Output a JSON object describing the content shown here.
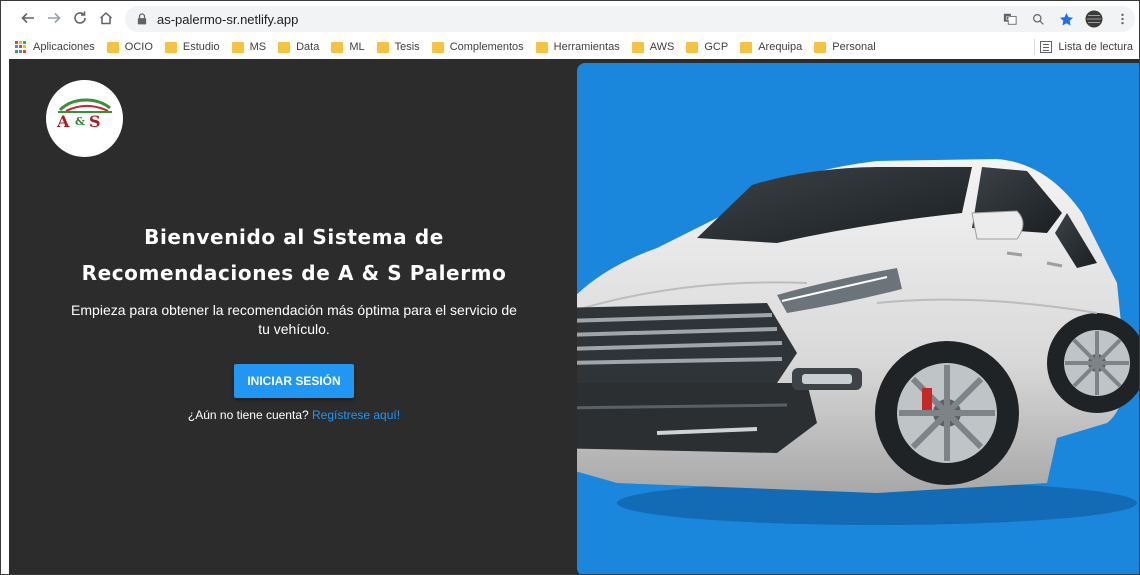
{
  "browser": {
    "url": "as-palermo-sr.netlify.app",
    "icons": {
      "back": "arrow-left-icon",
      "forward": "arrow-right-icon",
      "reload": "reload-icon",
      "home": "home-icon",
      "lock": "lock-icon",
      "translate": "translate-icon",
      "zoom": "magnifier-icon",
      "bookmark": "star-icon",
      "profile": "avatar-icon",
      "menu": "kebab-menu-icon"
    }
  },
  "bookmarks": {
    "apps_label": "Aplicaciones",
    "items": [
      "OCIO",
      "Estudio",
      "MS",
      "Data",
      "ML",
      "Tesis",
      "Complementos",
      "Herramientas",
      "AWS",
      "GCP",
      "Arequipa",
      "Personal"
    ],
    "reading_list_label": "Lista de lectura"
  },
  "hero": {
    "logo_text": "A&S",
    "title_line1": "Bienvenido al Sistema de",
    "title_line2": "Recomendaciones de A & S Palermo",
    "subtitle_line1": "Empieza para obtener la recomendación más óptima para el servicio de",
    "subtitle_line2": "tu vehículo.",
    "login_button": "INICIAR SESIÓN",
    "no_account_text": "¿Aún no tiene cuenta?",
    "register_link": "Regístrese aquí!"
  },
  "colors": {
    "left_background": "#2c2c2c",
    "right_background": "#1a86dc",
    "button": "#2196f3",
    "link": "#2196f3",
    "folder": "#f5c242"
  }
}
